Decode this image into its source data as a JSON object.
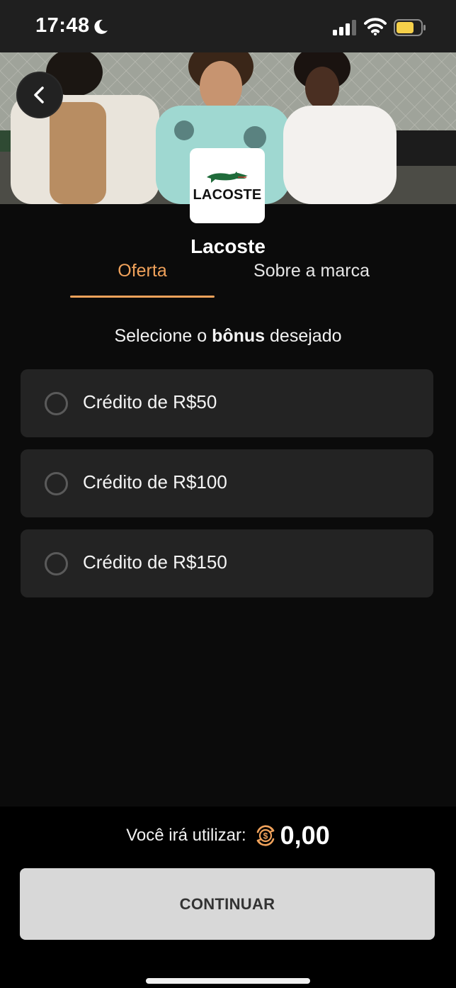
{
  "status_bar": {
    "time": "17:48",
    "icons": [
      "moon-icon",
      "signal-icon",
      "wifi-icon",
      "battery-icon"
    ],
    "battery_color": "#f5d04a"
  },
  "header": {
    "back_icon": "chevron-left-icon",
    "hero": "lacoste-campaign-photo"
  },
  "brand": {
    "logo_text": "LACOSTE",
    "name": "Lacoste"
  },
  "tabs": [
    {
      "label": "Oferta",
      "active": true
    },
    {
      "label": "Sobre a marca",
      "active": false
    }
  ],
  "prompt": {
    "before": "Selecione o ",
    "bold": "bônus",
    "after": " desejado"
  },
  "options": [
    {
      "label": "Crédito de R$50",
      "selected": false
    },
    {
      "label": "Crédito de R$100",
      "selected": false
    },
    {
      "label": "Crédito de R$150",
      "selected": false
    }
  ],
  "footer": {
    "usage_label": "Você irá utilizar:",
    "usage_icon": "coin-icon",
    "usage_amount": "0,00",
    "continue_label": "CONTINUAR"
  },
  "colors": {
    "accent": "#f0a25b",
    "background": "#0b0b0b",
    "card": "#232323",
    "button": "#d8d8d8"
  }
}
